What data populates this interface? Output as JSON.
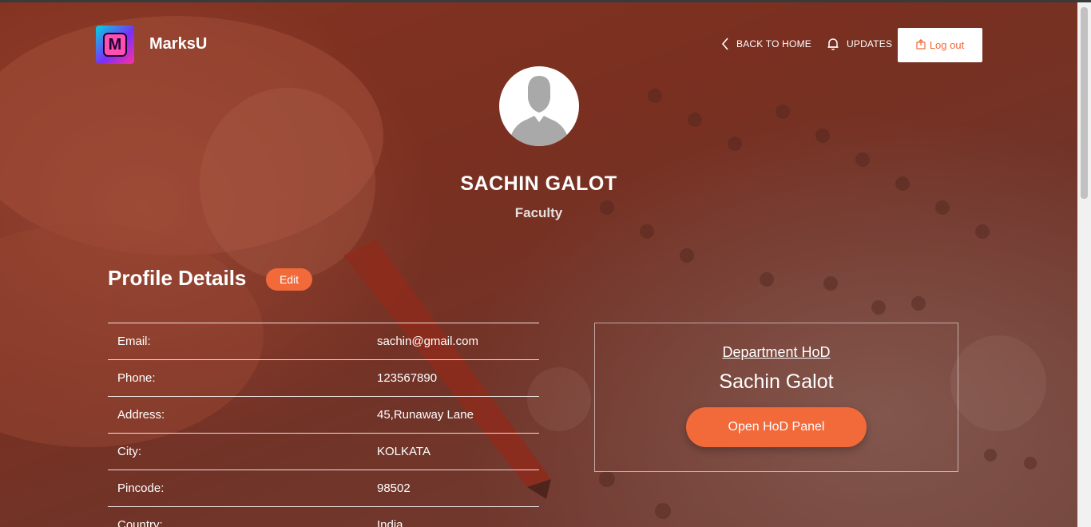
{
  "header": {
    "brand": "MarksU",
    "logo_letter": "M",
    "nav": {
      "back_home": "BACK TO HOME",
      "updates": "UPDATES",
      "logout": "Log out"
    }
  },
  "profile": {
    "name": "SACHIN GALOT",
    "role": "Faculty"
  },
  "details": {
    "title": "Profile Details",
    "edit_label": "Edit",
    "rows": [
      {
        "label": "Email:",
        "value": "sachin@gmail.com"
      },
      {
        "label": "Phone:",
        "value": "123567890"
      },
      {
        "label": "Address:",
        "value": "45,Runaway Lane"
      },
      {
        "label": "City:",
        "value": "KOLKATA"
      },
      {
        "label": "Pincode:",
        "value": "98502"
      },
      {
        "label": "Country:",
        "value": "India"
      }
    ]
  },
  "hod": {
    "label": "Department HoD",
    "name": "Sachin Galot",
    "button": "Open HoD Panel"
  },
  "colors": {
    "accent": "#f2693a",
    "background": "#7a3222"
  },
  "icons": {
    "back": "chevron-left-icon",
    "updates": "bell-icon",
    "logout": "logout-icon",
    "avatar": "user-silhouette-icon"
  }
}
